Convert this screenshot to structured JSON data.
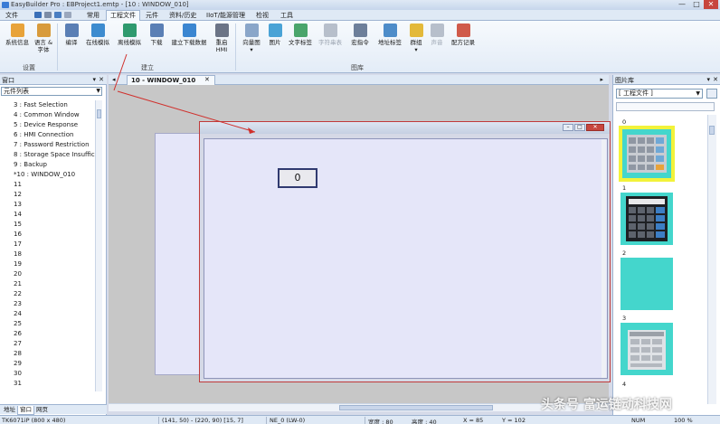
{
  "window": {
    "title": "EasyBuilder Pro : EBProject1.emtp - [10 : WINDOW_010]",
    "buttons": [
      "—",
      "□",
      "✕"
    ]
  },
  "menu": {
    "items": [
      "文件",
      "常用",
      "工程文件",
      "元件",
      "资料/历史",
      "IIoT/能源管理",
      "检视",
      "工具"
    ],
    "active_index": 2
  },
  "ribbon": {
    "buttons": [
      {
        "label": "系统信息",
        "label2": "",
        "icon": "system-info-icon",
        "color": "#e8a33a"
      },
      {
        "label": "语言 &",
        "label2": "字体",
        "icon": "language-font-icon",
        "color": "#d89b3c"
      },
      {
        "label": "编译",
        "label2": "",
        "icon": "compile-icon",
        "color": "#5a7fb5"
      },
      {
        "label": "在线模拟",
        "label2": "",
        "icon": "online-simulation-icon",
        "color": "#3e8ccf"
      },
      {
        "label": "离线模拟",
        "label2": "",
        "icon": "offline-simulation-icon",
        "color": "#2f9a6e"
      },
      {
        "label": "下载",
        "label2": "",
        "icon": "download-icon",
        "color": "#5a7fb5"
      },
      {
        "label": "建立下载数据",
        "label2": "",
        "icon": "build-download-data-icon",
        "color": "#3b86d1"
      },
      {
        "label": "重启",
        "label2": "HMI",
        "icon": "restart-hmi-icon",
        "color": "#6b7486"
      },
      {
        "label": "向量图",
        "label2": "▾",
        "icon": "vector-graphics-icon",
        "color": "#8aa6c9"
      },
      {
        "label": "图片",
        "label2": "",
        "icon": "picture-icon",
        "color": "#4aa3d6"
      },
      {
        "label": "文字标签",
        "label2": "",
        "icon": "text-tag-icon",
        "color": "#4aa56b"
      },
      {
        "label": "字符串表",
        "label2": "",
        "icon": "string-table-icon",
        "color": "#b7bfcb"
      },
      {
        "label": "宏指令",
        "label2": "",
        "icon": "macro-icon",
        "color": "#6d7f9a"
      },
      {
        "label": "地址标签",
        "label2": "",
        "icon": "address-tag-icon",
        "color": "#4d8cc9"
      },
      {
        "label": "群组",
        "label2": "▾",
        "icon": "group-icon",
        "color": "#e3b93a"
      },
      {
        "label": "声音",
        "label2": "",
        "icon": "sound-icon",
        "color": "#b7bfcb"
      },
      {
        "label": "配方记录",
        "label2": "",
        "icon": "recipe-icon",
        "color": "#d05a4a"
      }
    ],
    "groups": [
      "设置",
      "建立",
      "图库"
    ]
  },
  "left_panel": {
    "title": "窗口",
    "combo": "元件列表",
    "items": [
      "3 : Fast Selection",
      "4 : Common Window",
      "5 : Device Response",
      "6 : HMI Connection",
      "7 : Password Restriction",
      "8 : Storage Space Insufficie",
      "9 : Backup",
      "*10 : WINDOW_010",
      "11",
      "12",
      "13",
      "14",
      "15",
      "16",
      "17",
      "18",
      "19",
      "20",
      "21",
      "22",
      "23",
      "24",
      "25",
      "26",
      "27",
      "28",
      "29",
      "30",
      "31"
    ],
    "bottom_tabs": [
      "地址",
      "窗口",
      "网页"
    ],
    "active_tab": 1
  },
  "editor": {
    "tab_label": "10 - WINDOW_010",
    "numeric_display_value": "0"
  },
  "right_panel": {
    "title": "图片库",
    "combo": "[ 工程文件 ]",
    "items": [
      "0",
      "1",
      "2",
      "3",
      "4"
    ]
  },
  "status_bar": {
    "fields": [
      "TK6071iP (800 x 480)",
      "(141, 50) - (220, 90) [15, 7]",
      "NE_0 (LW-0)",
      "宽度 : 80",
      "高度 : 40",
      "X = 85",
      "Y = 102",
      "NUM",
      "100 %"
    ]
  },
  "watermark": "头条号 富运链动科技网",
  "colors": {
    "selection_red": "#c03a3a",
    "highlight_yellow": "#f2f23a",
    "library_teal": "#44d6cc"
  }
}
